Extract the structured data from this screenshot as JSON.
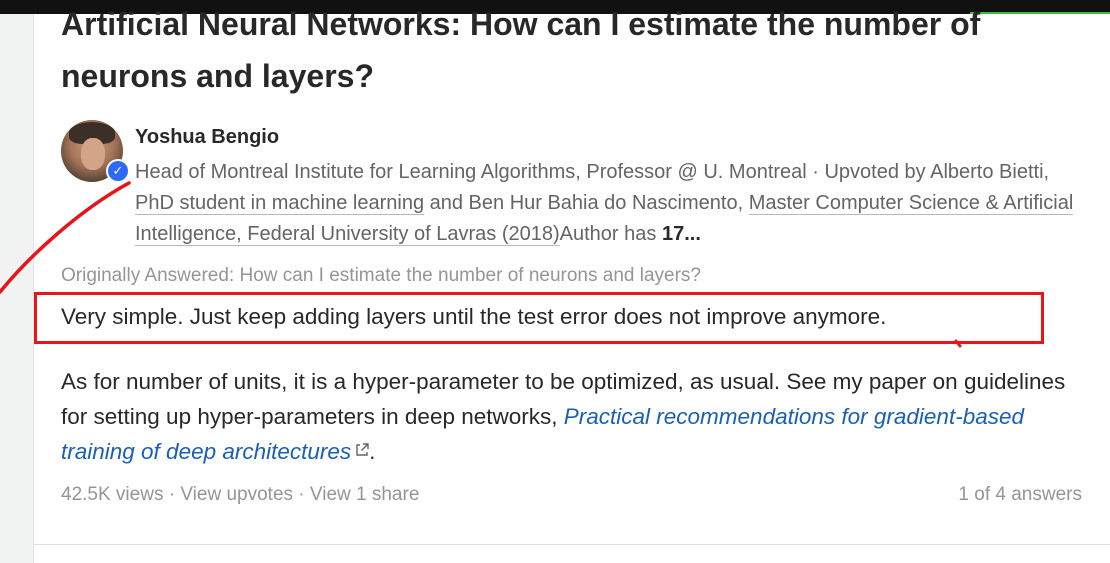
{
  "question": {
    "title": "Artificial Neural Networks: How can I estimate the number of neurons and layers?"
  },
  "author": {
    "name": "Yoshua Bengio",
    "credential_part1": "Head of Montreal Institute for Learning Algorithms, Professor @ U. Montreal · Upvoted by Alberto Bietti, ",
    "upvoter1_credential": "PhD student in machine learning",
    "credential_part2": " and Ben Hur Bahia do Nascimento, ",
    "upvoter2_credential": "Master Computer Science & Artificial Intelligence, Federal University of Lavras (2018)",
    "credential_part3": "Author has ",
    "answers_count": "17..."
  },
  "answer": {
    "originally_answered": "Originally Answered: How can I estimate the number of neurons and layers?",
    "highlighted_line": "Very simple. Just keep adding layers until the test error does not improve anymore.",
    "paragraph_part1": "As for number of units, it is a hyper-parameter to be optimized, as usual. See my paper on guidelines for setting up hyper-parameters in deep networks, ",
    "link_text": "Practical recommendations for gradient-based training of deep architectures",
    "paragraph_end": "."
  },
  "footer": {
    "views": "42.5K views",
    "separator": " · ",
    "view_upvotes": "View upvotes",
    "view_shares": "View 1 share",
    "position": "1 of 4 answers"
  },
  "colors": {
    "highlight": "#e8141a",
    "link": "#1a5fb4",
    "verified_badge": "#2e69ff"
  }
}
